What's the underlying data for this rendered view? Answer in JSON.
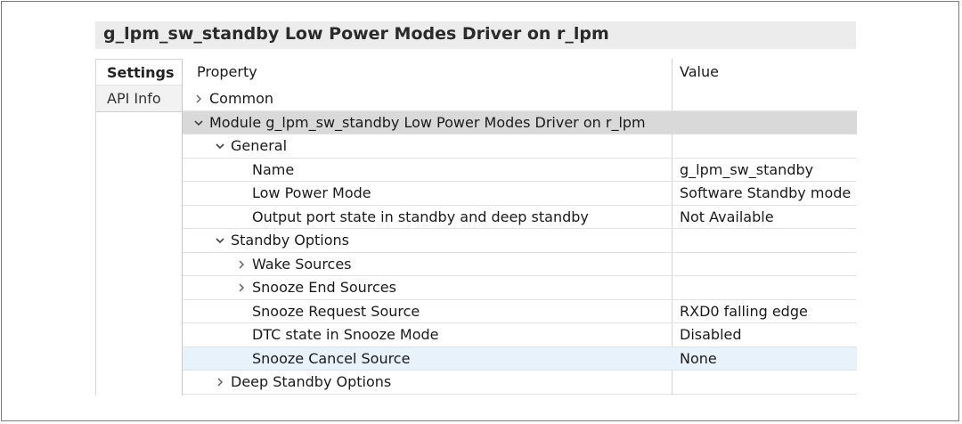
{
  "window": {
    "title": "g_lpm_sw_standby Low Power Modes Driver on r_lpm"
  },
  "tabs": [
    {
      "label": "Settings",
      "active": true
    },
    {
      "label": "API Info",
      "active": false
    }
  ],
  "table": {
    "headers": {
      "property": "Property",
      "value": "Value"
    },
    "rows": [
      {
        "label": "Common",
        "value": "",
        "level": 0,
        "expander": "collapsed"
      },
      {
        "label": "Module g_lpm_sw_standby Low Power Modes Driver on r_lpm",
        "value": "",
        "level": 0,
        "expander": "expanded"
      },
      {
        "label": "General",
        "value": "",
        "level": 1,
        "expander": "expanded"
      },
      {
        "label": "Name",
        "value": "g_lpm_sw_standby",
        "level": 2,
        "expander": "none"
      },
      {
        "label": "Low Power Mode",
        "value": "Software Standby mode",
        "level": 2,
        "expander": "none"
      },
      {
        "label": "Output port state in standby and deep standby",
        "value": "Not Available",
        "level": 2,
        "expander": "none"
      },
      {
        "label": "Standby Options",
        "value": "",
        "level": 1,
        "expander": "expanded"
      },
      {
        "label": "Wake Sources",
        "value": "",
        "level": 2,
        "expander": "collapsed"
      },
      {
        "label": "Snooze End Sources",
        "value": "",
        "level": 2,
        "expander": "collapsed"
      },
      {
        "label": "Snooze Request Source",
        "value": "RXD0 falling edge",
        "level": 2,
        "expander": "none"
      },
      {
        "label": "DTC state in Snooze Mode",
        "value": "Disabled",
        "level": 2,
        "expander": "none"
      },
      {
        "label": "Snooze Cancel Source",
        "value": "None",
        "level": 2,
        "expander": "none"
      },
      {
        "label": "Deep Standby Options",
        "value": "",
        "level": 1,
        "expander": "collapsed"
      }
    ]
  },
  "icons": {
    "collapsed": "chevron-right-icon",
    "expanded": "chevron-down-icon"
  },
  "colors": {
    "selected_row": "#d9d9d9",
    "hover_row": "#e8f2fb",
    "title_bar": "#ececec"
  }
}
